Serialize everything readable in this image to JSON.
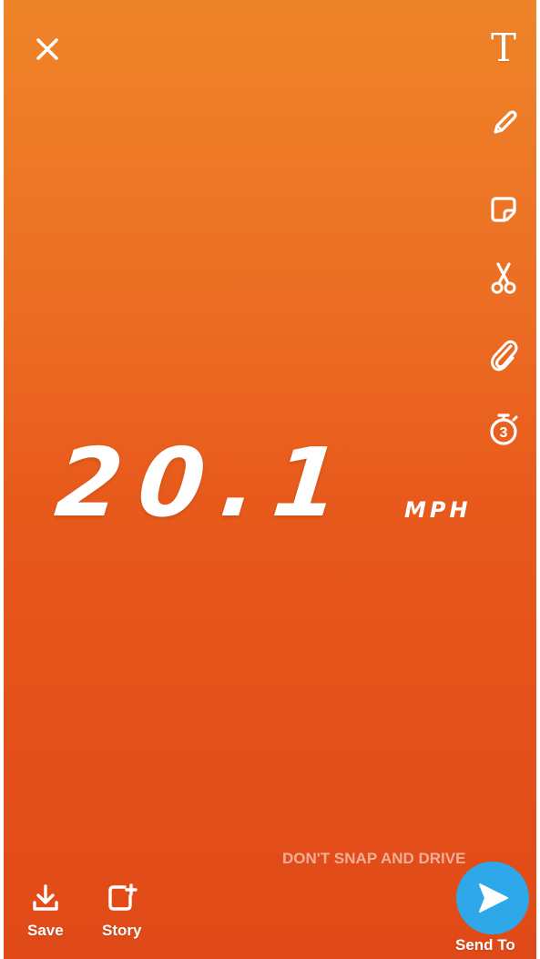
{
  "top_left": {
    "close_icon": "close-icon"
  },
  "toolbar": {
    "text_glyph": "T",
    "icons": [
      "text-icon",
      "pencil-icon",
      "sticker-icon",
      "scissors-icon",
      "paperclip-icon",
      "timer-icon"
    ],
    "timer_value": "3"
  },
  "speed_filter": {
    "value": "20.1",
    "unit": "MPH",
    "warning": "DON'T SNAP AND DRIVE"
  },
  "bottom_bar": {
    "save_label": "Save",
    "story_label": "Story",
    "send_label": "Send To"
  },
  "colors": {
    "background_top": "#ee8428",
    "background_bottom": "#e04a18",
    "send_button": "#2ea8e8",
    "foreground": "#ffffff"
  }
}
